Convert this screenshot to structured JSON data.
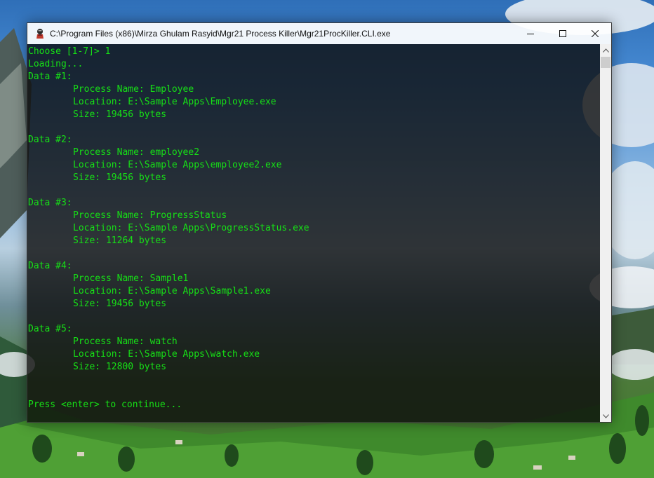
{
  "window": {
    "title": "C:\\Program Files (x86)\\Mirza Ghulam Rasyid\\Mgr21 Process Killer\\Mgr21ProcKiller.CLI.exe",
    "app_icon": "console-app-icon",
    "controls": {
      "minimize_icon": "minimize-icon",
      "maximize_icon": "maximize-icon",
      "close_icon": "close-icon"
    },
    "theme": {
      "console_text": "#16e016",
      "console_bg": "#0c0c0c",
      "titlebar_bg": "#ffffff"
    }
  },
  "console": {
    "prompt": "Choose [1-7]> 1",
    "status": "Loading...",
    "labels": {
      "process_name": "Process Name:",
      "location": "Location:",
      "size": "Size:"
    },
    "entries": [
      {
        "header": "Data #1:",
        "process_name": "Employee",
        "location": "E:\\Sample Apps\\Employee.exe",
        "size": "19456 bytes"
      },
      {
        "header": "Data #2:",
        "process_name": "employee2",
        "location": "E:\\Sample Apps\\employee2.exe",
        "size": "19456 bytes"
      },
      {
        "header": "Data #3:",
        "process_name": "ProgressStatus",
        "location": "E:\\Sample Apps\\ProgressStatus.exe",
        "size": "11264 bytes"
      },
      {
        "header": "Data #4:",
        "process_name": "Sample1",
        "location": "E:\\Sample Apps\\Sample1.exe",
        "size": "19456 bytes"
      },
      {
        "header": "Data #5:",
        "process_name": "watch",
        "location": "E:\\Sample Apps\\watch.exe",
        "size": "12800 bytes"
      }
    ],
    "continue_prompt": "Press <enter> to continue..."
  },
  "scrollbar": {
    "up_icon": "scroll-up-arrow-icon",
    "down_icon": "scroll-down-arrow-icon",
    "scroll_position": 0
  }
}
